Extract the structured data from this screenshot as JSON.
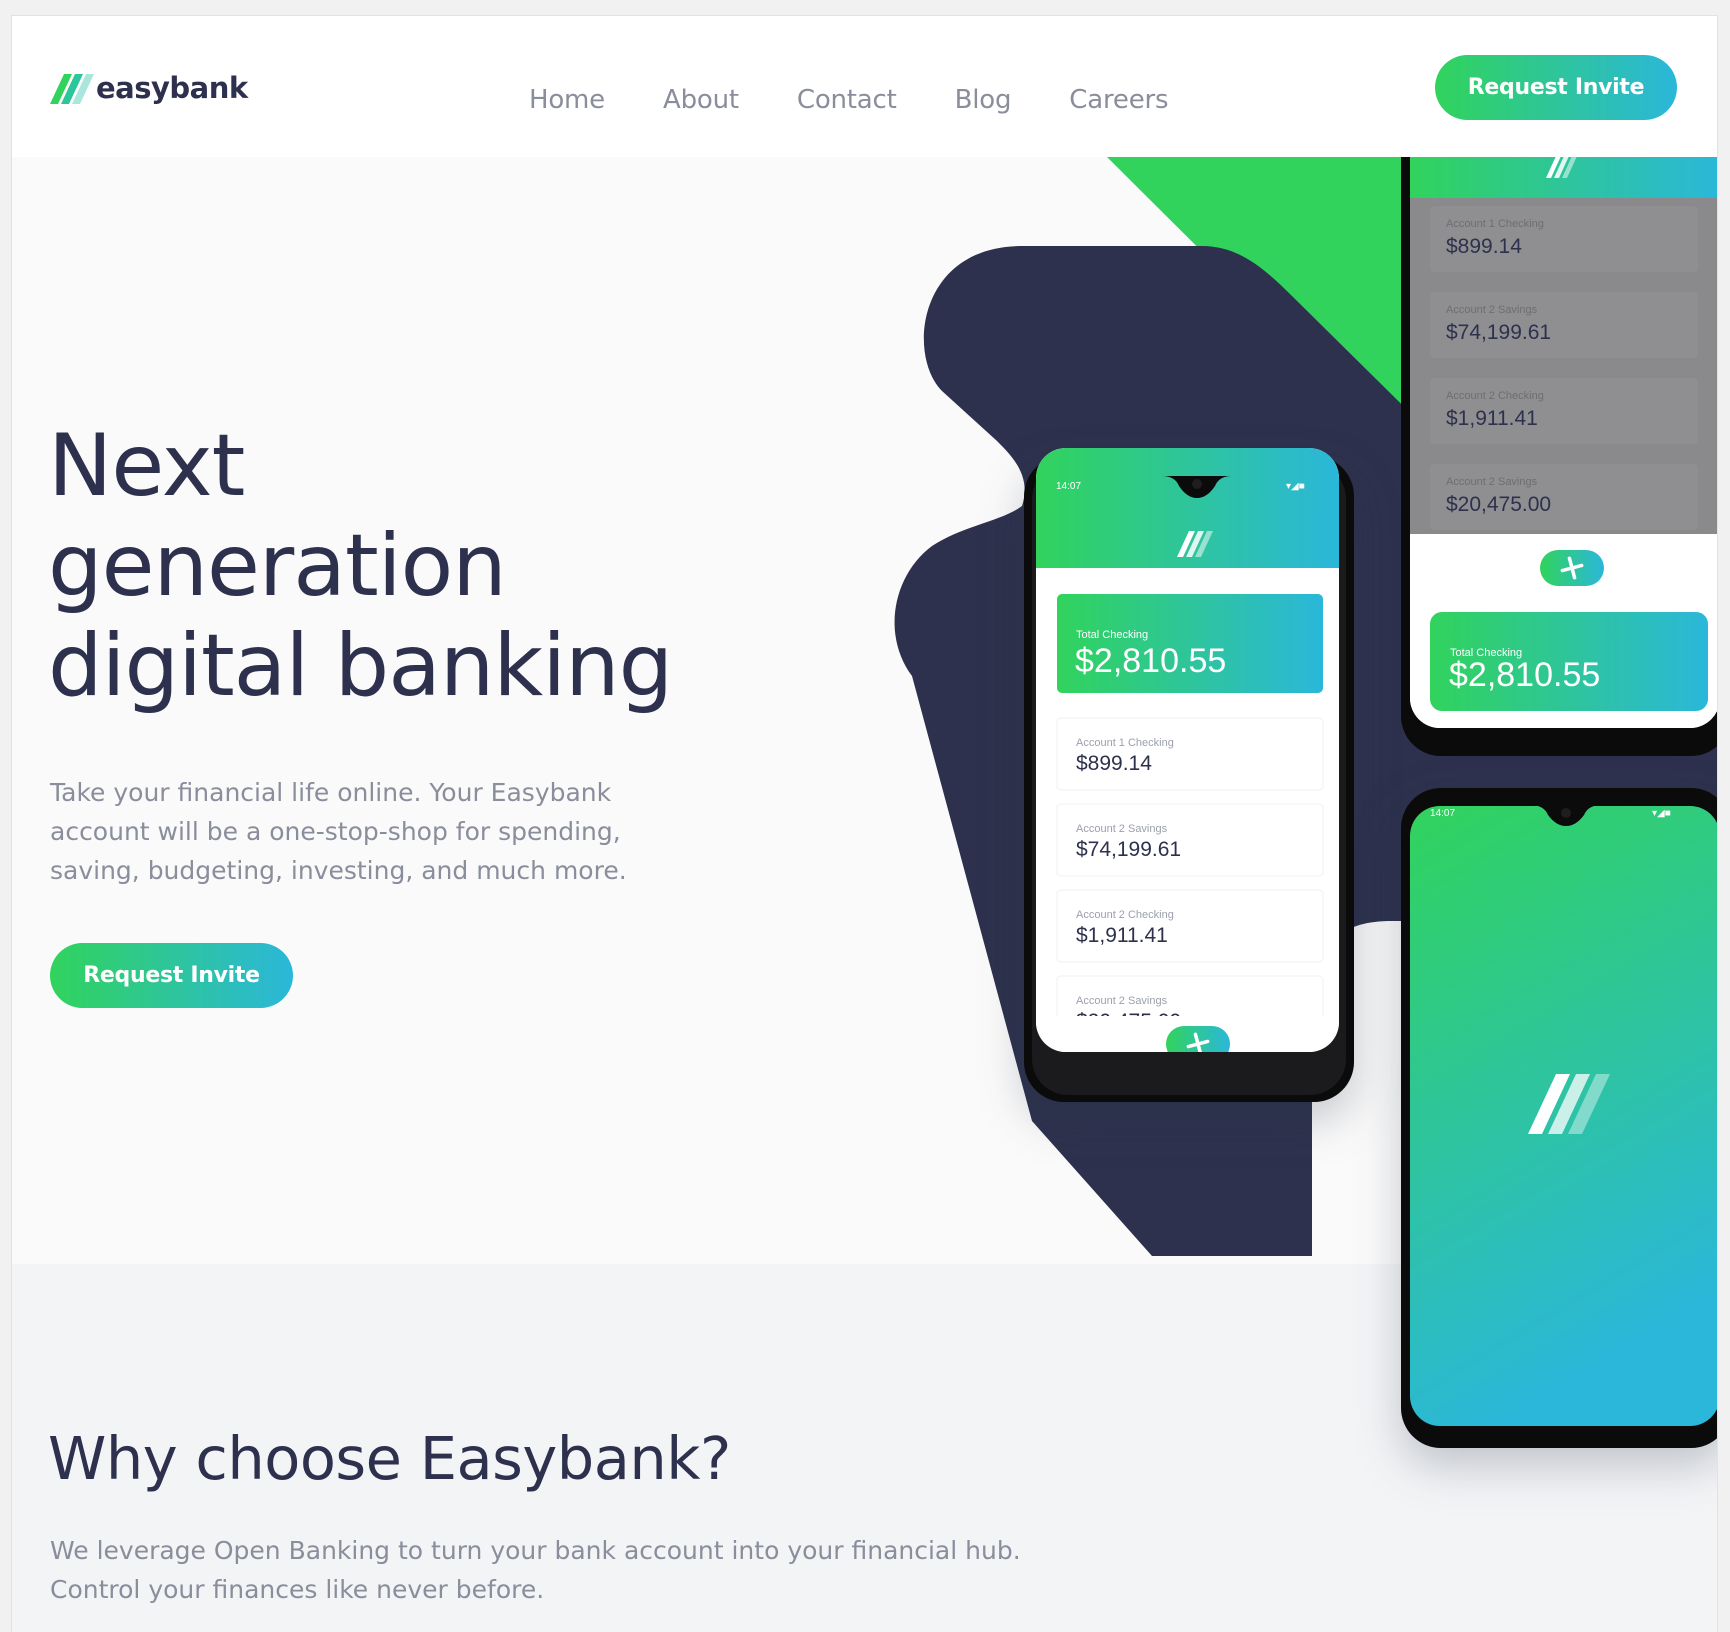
{
  "brand": {
    "name": "easybank",
    "green": "#31d35c",
    "cyan": "#2bb7da",
    "navy": "#2d314d",
    "grayish_blue": "#8a8d9c"
  },
  "nav": {
    "items": [
      "Home",
      "About",
      "Contact",
      "Blog",
      "Careers"
    ],
    "cta_label": "Request Invite"
  },
  "hero": {
    "title_lines": [
      "Next",
      "generation",
      "digital banking"
    ],
    "description": "Take your financial life online. Your Easybank account will be a one-stop-shop for spending, saving, budgeting, investing, and much more.",
    "cta_label": "Request Invite"
  },
  "mockups": {
    "status_time": "14:07",
    "total_label": "Total Checking",
    "total_amount": "$2,810.55",
    "accounts": [
      {
        "label": "Account 1 Checking",
        "amount": "$899.14"
      },
      {
        "label": "Account 2 Savings",
        "amount": "$74,199.61"
      },
      {
        "label": "Account 2 Checking",
        "amount": "$1,911.41"
      },
      {
        "label": "Account 2 Savings",
        "amount": "$20,475.00"
      }
    ],
    "add_icon": "plus-icon",
    "app_icon": "easybank-logo-icon"
  },
  "why": {
    "title": "Why choose Easybank?",
    "description": "We leverage Open Banking to turn your bank account into your financial hub. Control your finances like never before."
  }
}
